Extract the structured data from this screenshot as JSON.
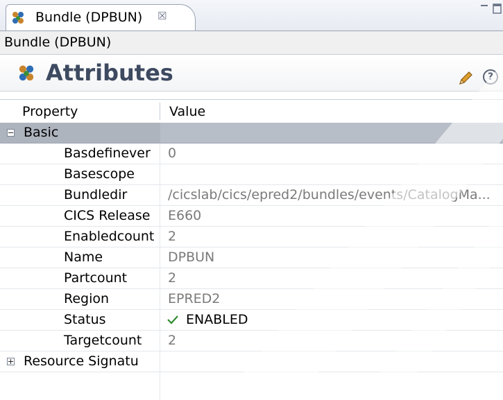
{
  "tab": {
    "title": "Bundle (DPBUN)",
    "close_glyph": "☒",
    "icon": "bundle-icon"
  },
  "editor": {
    "label": "Bundle (DPBUN)"
  },
  "section": {
    "title": "Attributes",
    "icon": "bundle-icon",
    "edit_icon": "pencil-icon",
    "help_glyph": "?"
  },
  "table": {
    "headers": {
      "property": "Property",
      "value": "Value"
    },
    "groups": [
      {
        "label": "Basic",
        "expanded": true,
        "rows": [
          {
            "property": "Basdefinever",
            "value": "0"
          },
          {
            "property": "Basescope",
            "value": ""
          },
          {
            "property": "Bundledir",
            "value": "/cicslab/cics/epred2/bundles/events/CatalogMa..."
          },
          {
            "property": "CICS Release",
            "value": "E660"
          },
          {
            "property": "Enabledcount",
            "value": "2"
          },
          {
            "property": "Name",
            "value": "DPBUN"
          },
          {
            "property": "Partcount",
            "value": "2"
          },
          {
            "property": "Region",
            "value": "EPRED2"
          },
          {
            "property": "Status",
            "value": "ENABLED",
            "icon": "check-icon"
          },
          {
            "property": "Targetcount",
            "value": "2"
          }
        ]
      },
      {
        "label": "Resource Signatu",
        "expanded": false,
        "rows": []
      }
    ]
  },
  "colors": {
    "group_row": "#aeb4be",
    "section_title": "#3d4a60",
    "muted_value": "#7a7a7a",
    "check_green": "#2e8b2e"
  }
}
